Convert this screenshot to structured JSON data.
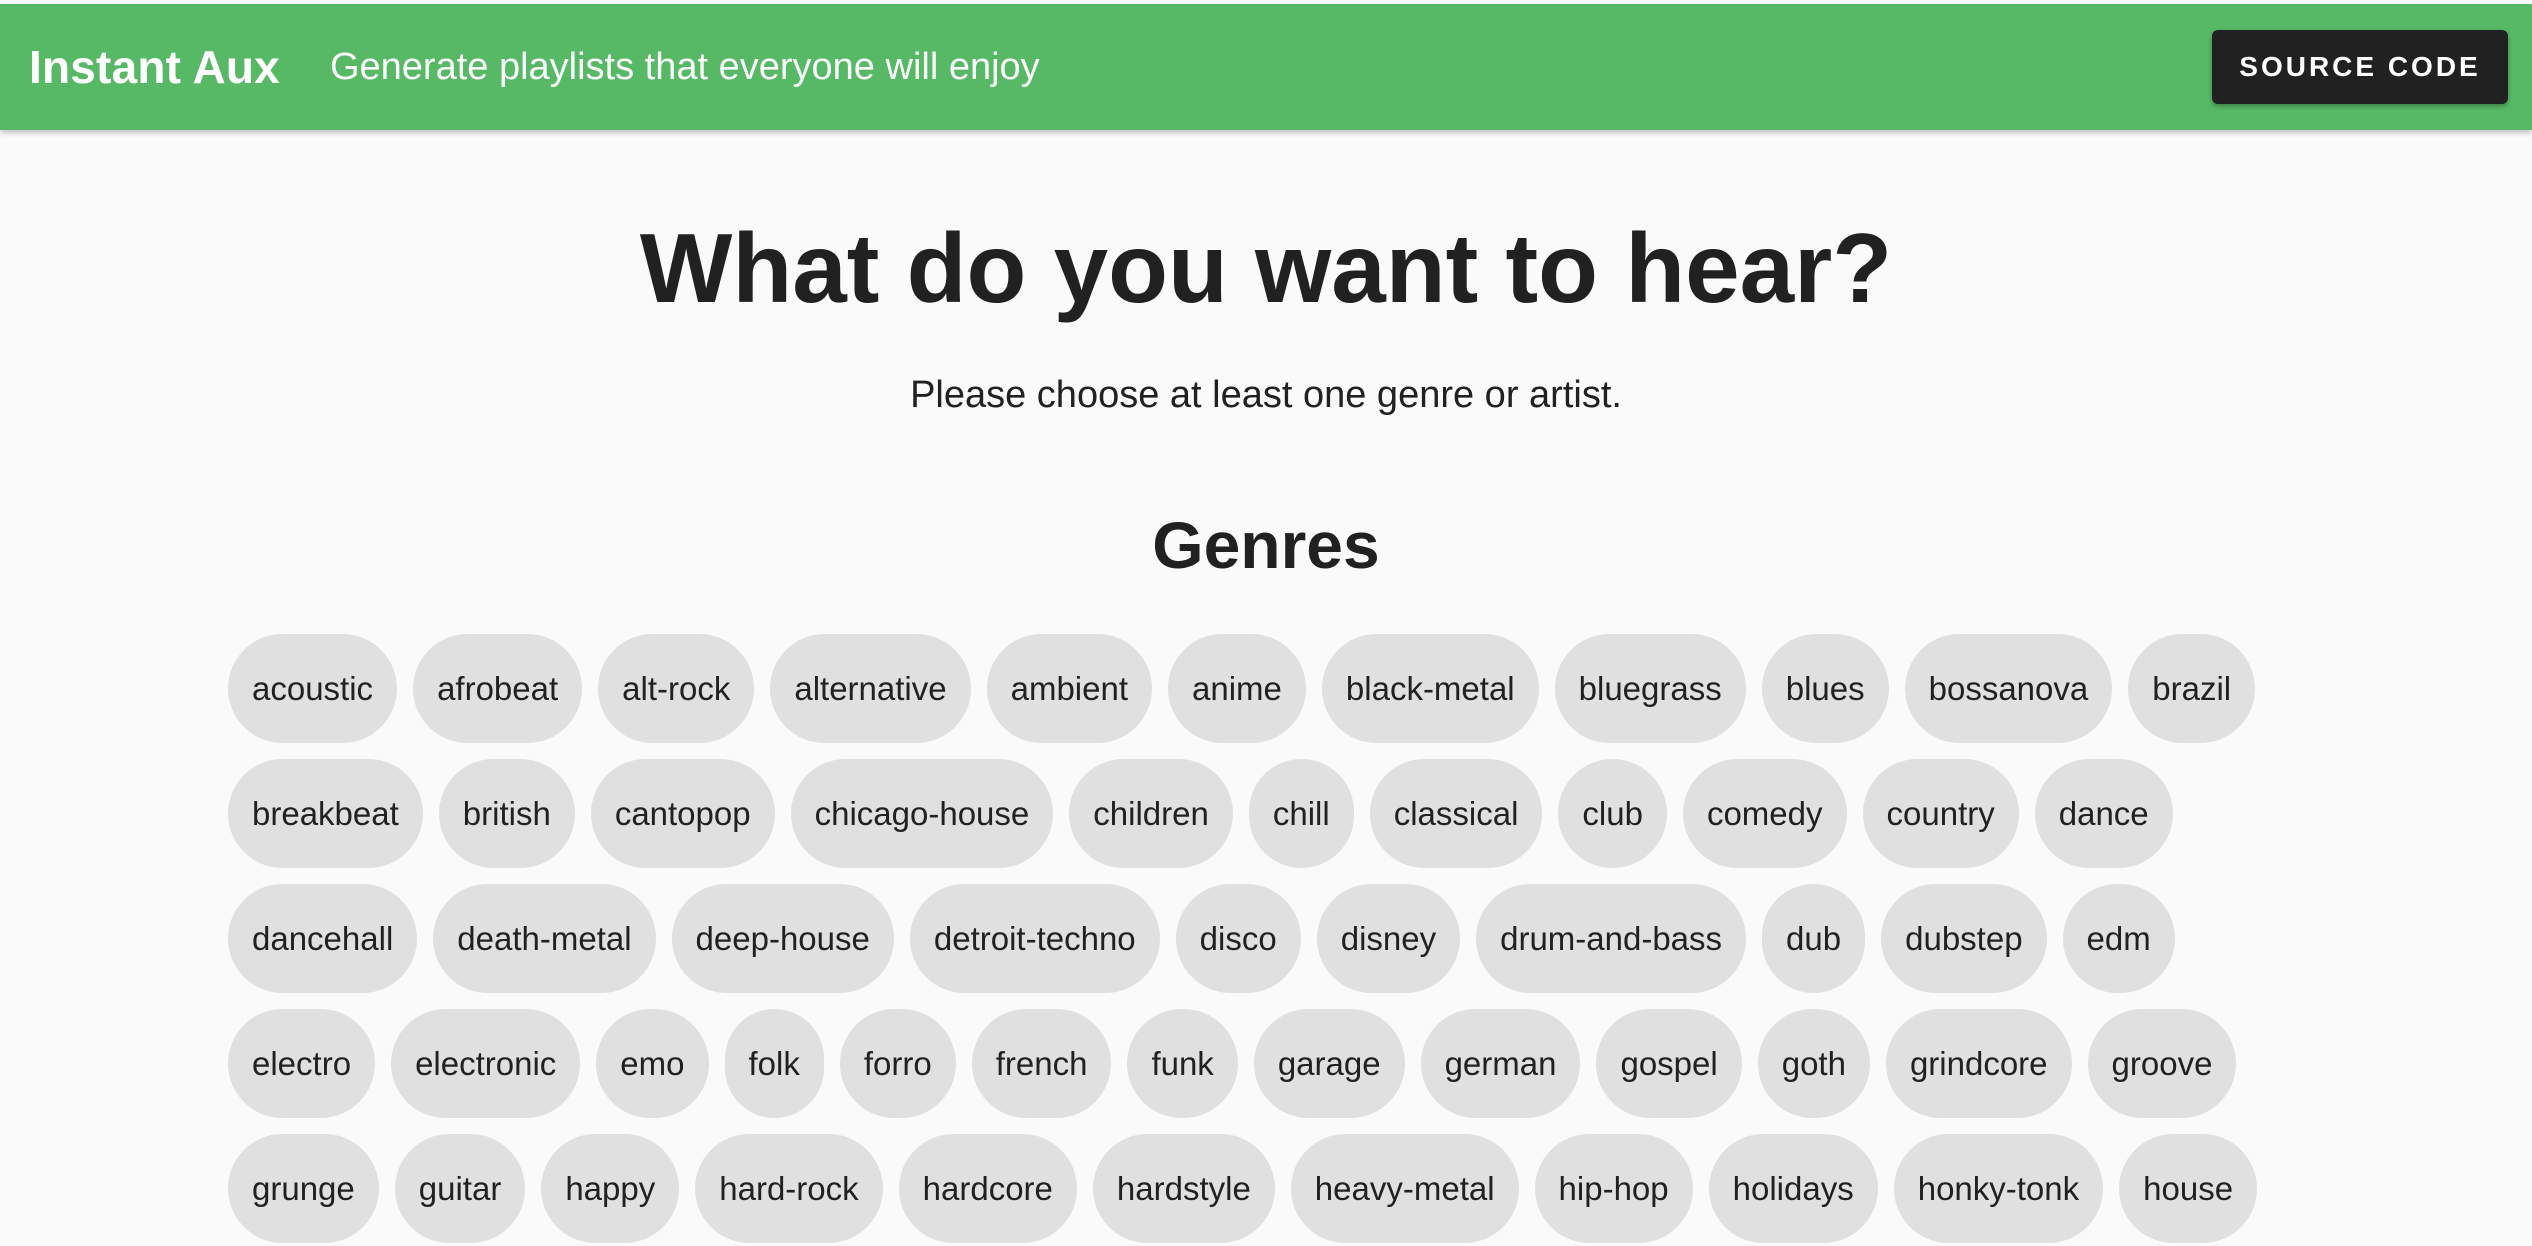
{
  "appbar": {
    "brand": "Instant Aux",
    "tagline": "Generate playlists that everyone will enjoy",
    "source_button": "SOURCE CODE",
    "color": "#57b865"
  },
  "main": {
    "heading": "What do you want to hear?",
    "subtitle": "Please choose at least one genre or artist.",
    "genres_heading": "Genres"
  },
  "genres": [
    "acoustic",
    "afrobeat",
    "alt-rock",
    "alternative",
    "ambient",
    "anime",
    "black-metal",
    "bluegrass",
    "blues",
    "bossanova",
    "brazil",
    "breakbeat",
    "british",
    "cantopop",
    "chicago-house",
    "children",
    "chill",
    "classical",
    "club",
    "comedy",
    "country",
    "dance",
    "dancehall",
    "death-metal",
    "deep-house",
    "detroit-techno",
    "disco",
    "disney",
    "drum-and-bass",
    "dub",
    "dubstep",
    "edm",
    "electro",
    "electronic",
    "emo",
    "folk",
    "forro",
    "french",
    "funk",
    "garage",
    "german",
    "gospel",
    "goth",
    "grindcore",
    "groove",
    "grunge",
    "guitar",
    "happy",
    "hard-rock",
    "hardcore",
    "hardstyle",
    "heavy-metal",
    "hip-hop",
    "holidays",
    "honky-tonk",
    "house"
  ],
  "colors": {
    "chip_background": "#e0e0e0",
    "button_background": "#212121",
    "text": "#212121",
    "page_background": "#fafafa"
  }
}
